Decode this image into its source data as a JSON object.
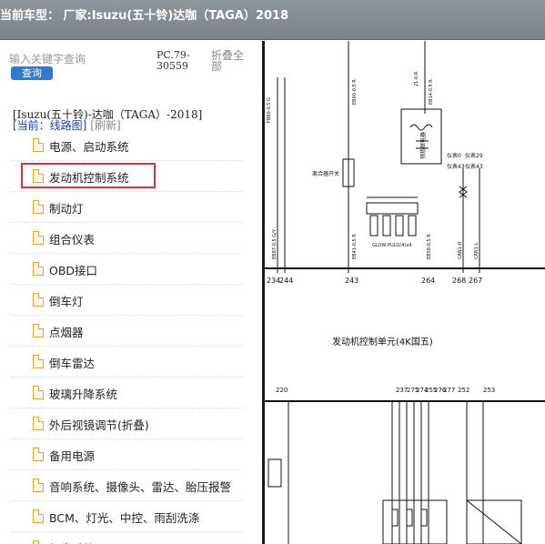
{
  "header": {
    "title": "当前车型：  厂家:Isuzu(五十铃)达咖（TAGA）2018"
  },
  "search": {
    "placeholder": "输入关键字查询",
    "button_label": "查询"
  },
  "pc_code": "PC.79-30559",
  "fold_all_label": "折叠全部",
  "vehicle_line": "[Isuzu(五十铃)-达咖（TAGA）-2018]",
  "current": {
    "label": "[当前：线路图]",
    "refresh": "[刷新]"
  },
  "tree": [
    {
      "label": "电源、启动系统"
    },
    {
      "label": "发动机控制系统",
      "selected": true
    },
    {
      "label": "制动灯"
    },
    {
      "label": "组合仪表"
    },
    {
      "label": "OBD接口"
    },
    {
      "label": "倒车灯"
    },
    {
      "label": "点烟器"
    },
    {
      "label": "倒车雷达"
    },
    {
      "label": "玻璃升降系统"
    },
    {
      "label": "外后视镜调节(折叠)"
    },
    {
      "label": "备用电源"
    },
    {
      "label": "音响系统、摄像头、雷达、胎压报警"
    },
    {
      "label": "BCM、灯光、中控、雨刮洗涤"
    },
    {
      "label": "气囊系统"
    }
  ],
  "diagram": {
    "title": "发动机控制单元(4K国五)",
    "top_pins": [
      "234",
      "244",
      "243",
      "264",
      "268",
      "267"
    ],
    "bottom_pins": [
      "220",
      "237",
      "275",
      "274",
      "255",
      "276",
      "277",
      "252",
      "253"
    ],
    "labels": {
      "relay": "预热继电器",
      "glow": "GLOW PULG(4)x4",
      "clutch": "离合器开关",
      "meter1": "仪表0",
      "meter2": "仪表29",
      "meter_sub1": "仪表43",
      "meter_sub2": "仪表43"
    }
  }
}
